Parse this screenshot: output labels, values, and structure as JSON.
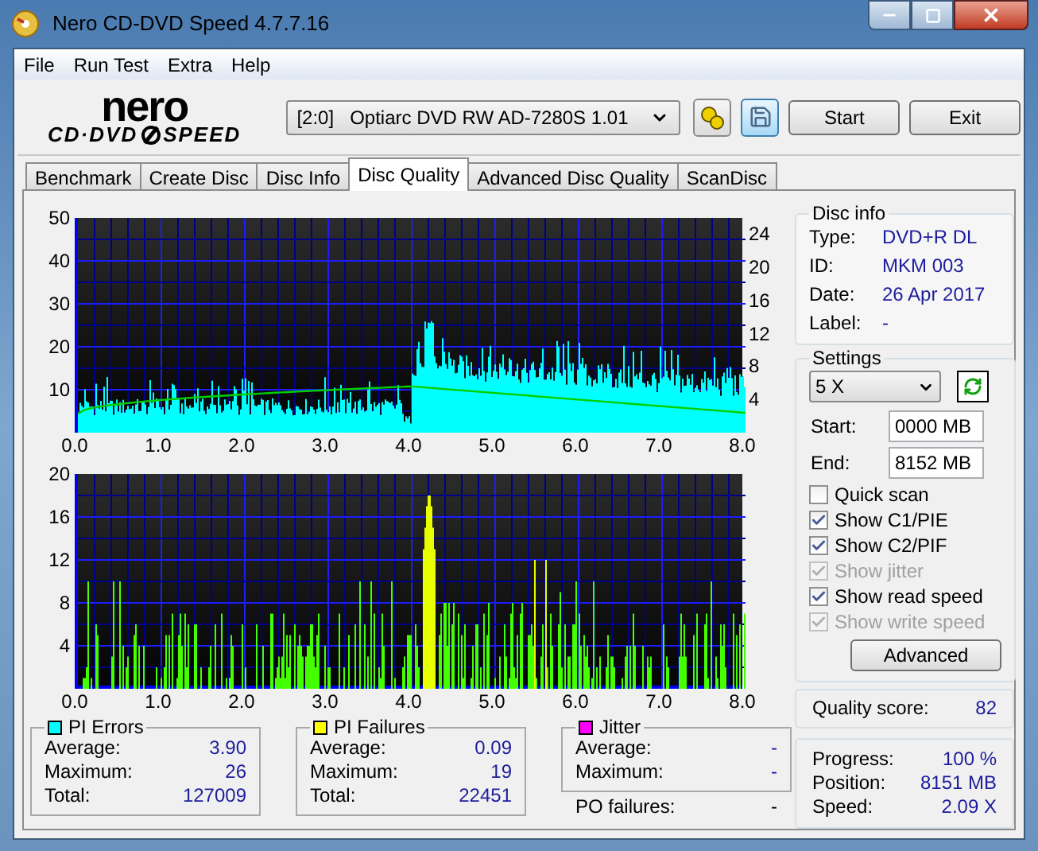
{
  "window": {
    "title": "Nero CD-DVD Speed 4.7.7.16"
  },
  "menu": [
    "File",
    "Run Test",
    "Extra",
    "Help"
  ],
  "logo": {
    "top": "nero",
    "left": "CD·DVD",
    "right": "SPEED"
  },
  "drive": {
    "value": "[2:0]   Optiarc DVD RW AD-7280S 1.01"
  },
  "buttons": [
    "Start",
    "Exit"
  ],
  "tabs": [
    {
      "label": "Benchmark",
      "selected": false
    },
    {
      "label": "Create Disc",
      "selected": false
    },
    {
      "label": "Disc Info",
      "selected": false
    },
    {
      "label": "Disc Quality",
      "selected": true
    },
    {
      "label": "Advanced Disc Quality",
      "selected": false
    },
    {
      "label": "ScanDisc",
      "selected": false
    }
  ],
  "pie_chart": {
    "left_ticks": [
      "50",
      "40",
      "30",
      "20",
      "10"
    ],
    "right_ticks": [
      "24",
      "20",
      "16",
      "12",
      "8",
      "4"
    ],
    "x_ticks": [
      "0.0",
      "1.0",
      "2.0",
      "3.0",
      "4.0",
      "5.0",
      "6.0",
      "7.0",
      "8.0"
    ]
  },
  "pif_chart": {
    "left_ticks": [
      "20",
      "16",
      "12",
      "8",
      "4"
    ],
    "x_ticks": [
      "0.0",
      "1.0",
      "2.0",
      "3.0",
      "4.0",
      "5.0",
      "6.0",
      "7.0",
      "8.0"
    ]
  },
  "stats": [
    {
      "title": "PI Errors",
      "color": "#00ffff",
      "rows": [
        {
          "label": "Average:",
          "value": "3.90"
        },
        {
          "label": "Maximum:",
          "value": "26"
        },
        {
          "label": "Total:",
          "value": "127009"
        }
      ]
    },
    {
      "title": "PI Failures",
      "color": "#ffff00",
      "rows": [
        {
          "label": "Average:",
          "value": "0.09"
        },
        {
          "label": "Maximum:",
          "value": "19"
        },
        {
          "label": "Total:",
          "value": "22451"
        }
      ]
    },
    {
      "title": "Jitter",
      "color": "#ff00ff",
      "rows": [
        {
          "label": "Average:",
          "value": "-"
        },
        {
          "label": "Maximum:",
          "value": "-"
        }
      ]
    }
  ],
  "po_failures": {
    "label": "PO failures:",
    "value": "-"
  },
  "disc_info": {
    "title": "Disc info",
    "rows": [
      {
        "label": "Type:",
        "value": "DVD+R DL"
      },
      {
        "label": "ID:",
        "value": "MKM 003"
      },
      {
        "label": "Date:",
        "value": "26 Apr 2017"
      },
      {
        "label": "Label:",
        "value": "-"
      }
    ]
  },
  "settings": {
    "title": "Settings",
    "speed": "5 X",
    "start_label": "Start:",
    "start": "0000 MB",
    "end_label": "End:",
    "end": "8152 MB",
    "checkboxes": [
      {
        "label": "Quick scan",
        "checked": false,
        "disabled": false
      },
      {
        "label": "Show C1/PIE",
        "checked": true,
        "disabled": false
      },
      {
        "label": "Show C2/PIF",
        "checked": true,
        "disabled": false
      },
      {
        "label": "Show jitter",
        "checked": true,
        "disabled": true
      },
      {
        "label": "Show read speed",
        "checked": true,
        "disabled": false
      },
      {
        "label": "Show write speed",
        "checked": true,
        "disabled": true
      }
    ],
    "advanced": "Advanced"
  },
  "quality": {
    "label": "Quality score:",
    "value": "82"
  },
  "progress": [
    {
      "label": "Progress:",
      "value": "100 %"
    },
    {
      "label": "Position:",
      "value": "8151 MB"
    },
    {
      "label": "Speed:",
      "value": "2.09 X"
    }
  ]
}
